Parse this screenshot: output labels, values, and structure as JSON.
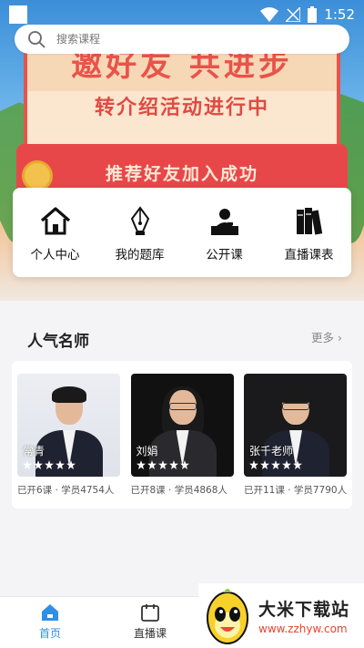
{
  "status_bar": {
    "time": "1:52"
  },
  "search": {
    "placeholder": "搜索课程"
  },
  "banner": {
    "headline": "邀好友 共进步",
    "subtitle": "转介绍活动进行中",
    "recommend": "推荐好友加入成功"
  },
  "quick_menu": [
    {
      "label": "个人中心",
      "icon": "home-icon"
    },
    {
      "label": "我的题库",
      "icon": "pen-icon"
    },
    {
      "label": "公开课",
      "icon": "lecturer-icon"
    },
    {
      "label": "直播课表",
      "icon": "books-icon"
    }
  ],
  "popular": {
    "title": "人气名师",
    "more": "更多 ›"
  },
  "teachers": [
    {
      "name": "常青",
      "stats": "已开6课 · 学员4754人",
      "stars": 5
    },
    {
      "name": "刘娟",
      "stats": "已开8课 · 学员4868人",
      "stars": 5
    },
    {
      "name": "张千老师",
      "stats": "已开11课 · 学员7790人",
      "stars": 5
    }
  ],
  "tabbar": {
    "home": "首页",
    "live": "直播课"
  },
  "watermark": {
    "title": "大米下载站",
    "url": "www.zzhyw.com"
  },
  "colors": {
    "accent": "#2f8fe6",
    "banner_red": "#e8534a"
  }
}
